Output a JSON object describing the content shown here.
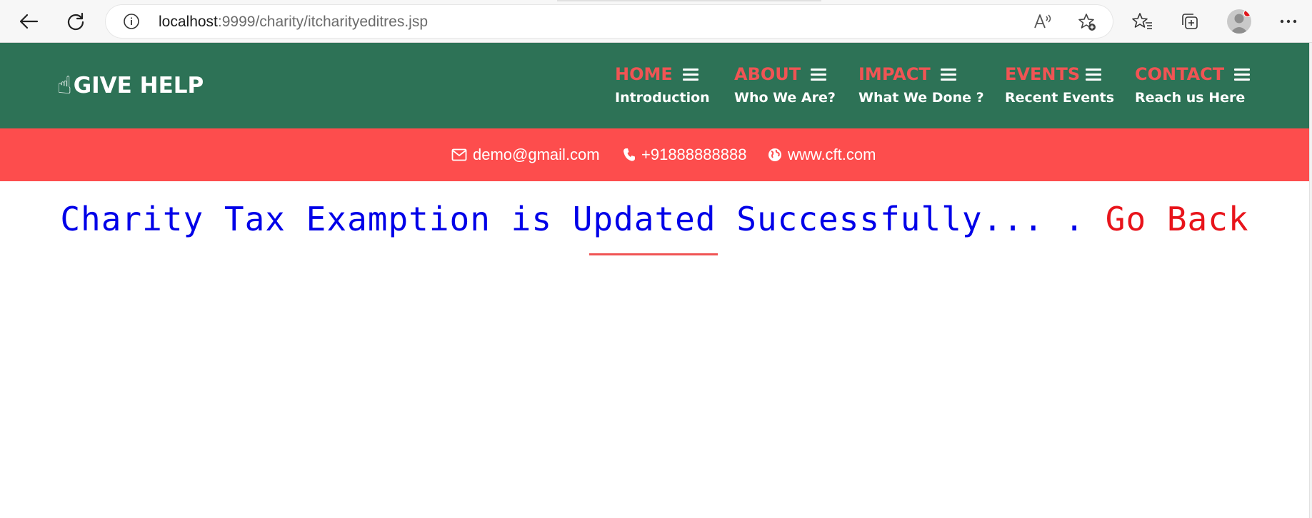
{
  "browser": {
    "url_host": "localhost",
    "url_path": ":9999/charity/itcharityeditres.jsp",
    "icons": [
      "back-arrow-icon",
      "refresh-icon",
      "info-icon",
      "read-aloud-icon",
      "add-favorite-icon",
      "favorites-icon",
      "collections-icon",
      "profile-avatar",
      "more-options-icon"
    ]
  },
  "site": {
    "logo_text": "GIVE HELP",
    "logo_glyph": "☝",
    "nav": [
      {
        "title": "HOME",
        "sub": "Introduction"
      },
      {
        "title": "ABOUT",
        "sub": "Who We Are?"
      },
      {
        "title": "IMPACT",
        "sub": "What We Done ?"
      },
      {
        "title": "EVENTS",
        "sub": "Recent Events"
      },
      {
        "title": "CONTACT",
        "sub": "Reach us Here"
      }
    ],
    "contact": {
      "email": "demo@gmail.com",
      "phone": "+91888888888",
      "website": "www.cft.com"
    }
  },
  "message": {
    "text": "Charity Tax Examption is Updated Successfully... . ",
    "link": "Go Back"
  },
  "colors": {
    "header_bg": "#2d7256",
    "band_bg": "#fd4d4d",
    "nav_title": "#f05454",
    "message_text": "#0000e8",
    "go_back": "#e8141b"
  }
}
